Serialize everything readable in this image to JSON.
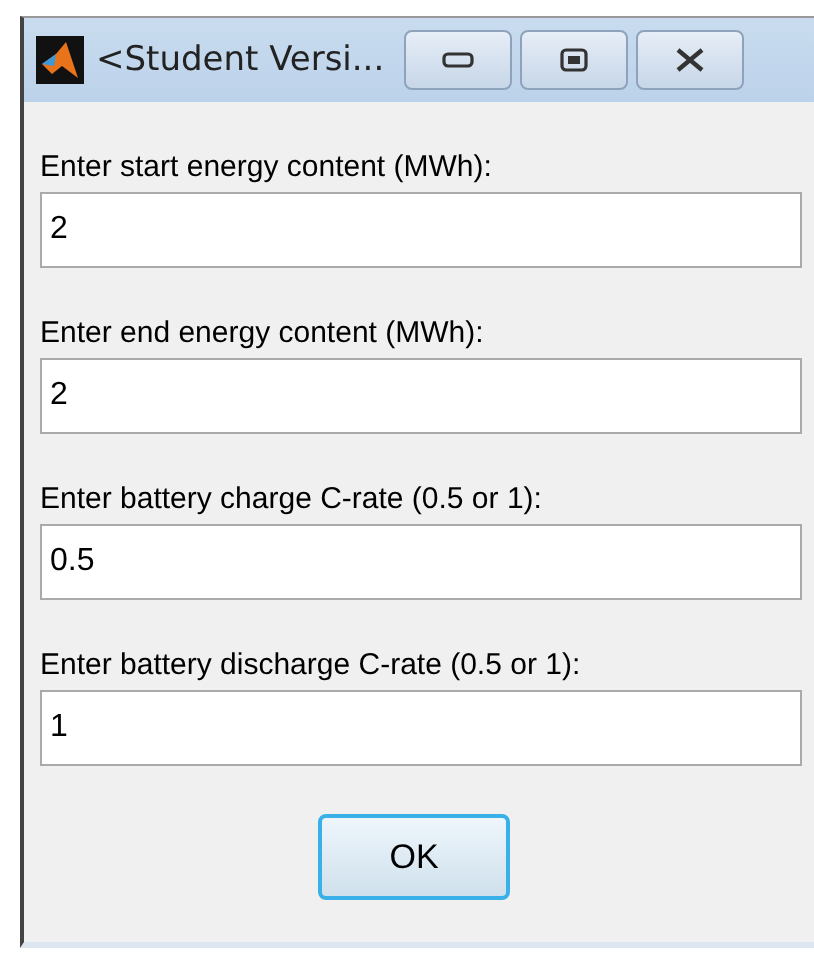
{
  "window": {
    "title": "<Student Versi..."
  },
  "fields": [
    {
      "label": "Enter start energy content (MWh):",
      "value": "2"
    },
    {
      "label": "Enter end energy content (MWh):",
      "value": "2"
    },
    {
      "label": "Enter battery charge C-rate (0.5 or 1):",
      "value": "0.5"
    },
    {
      "label": "Enter battery discharge C-rate (0.5 or 1):",
      "value": "1"
    }
  ],
  "buttons": [
    "OK"
  ]
}
